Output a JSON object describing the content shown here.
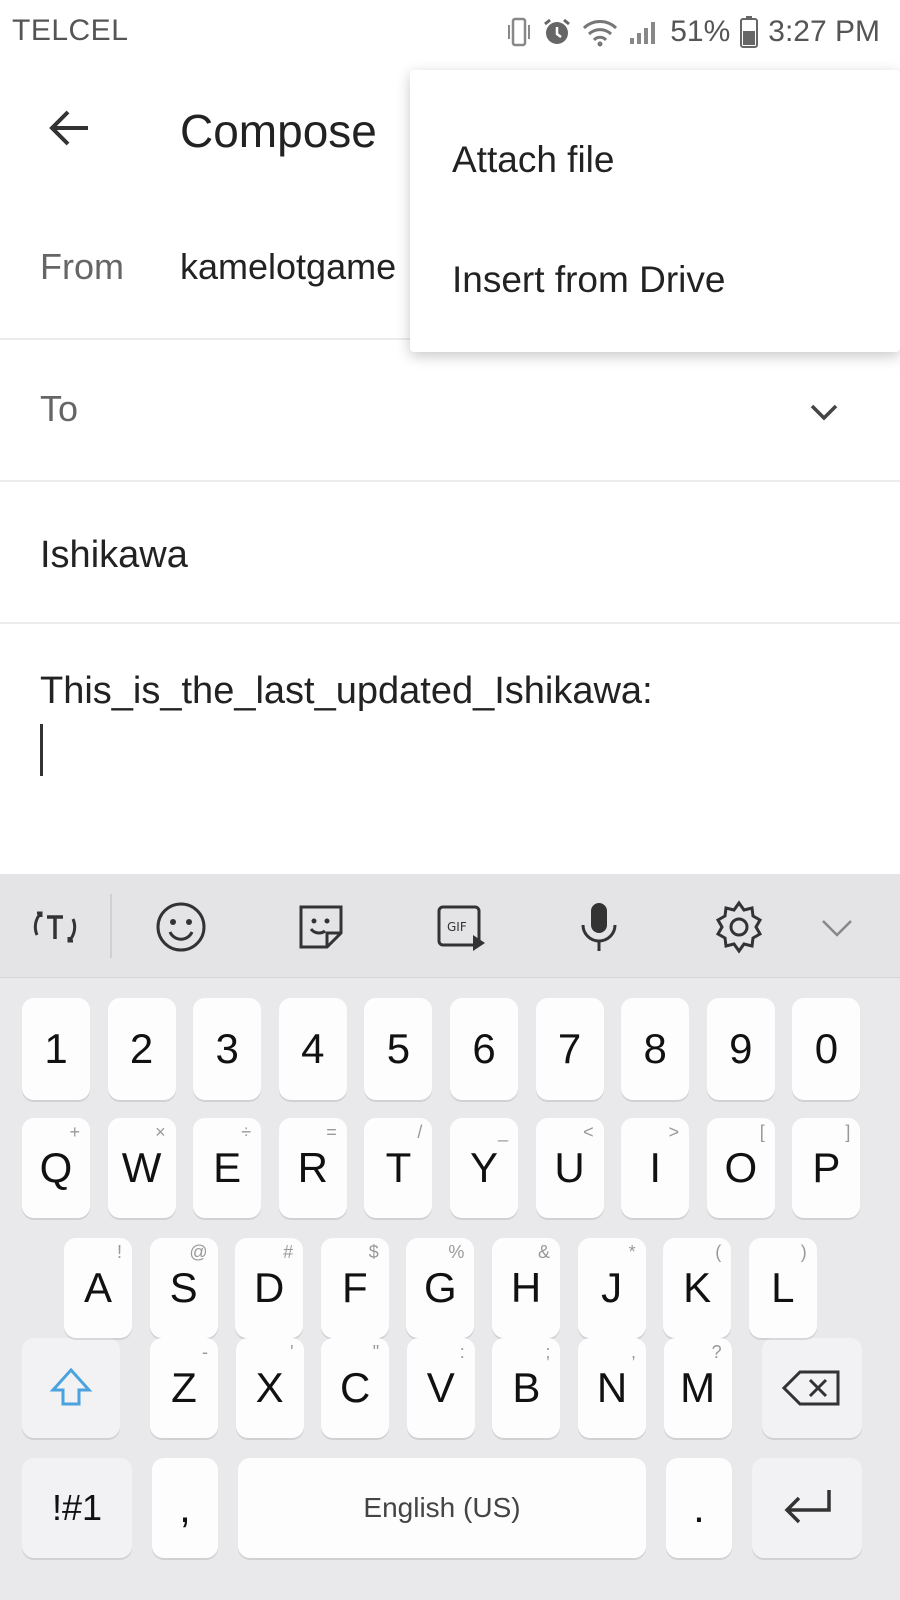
{
  "status_bar": {
    "carrier": "TELCEL",
    "battery": "51%",
    "time": "3:27 PM"
  },
  "app_bar": {
    "title": "Compose"
  },
  "from": {
    "label": "From",
    "value": "kamelotgame"
  },
  "to": {
    "label": "To"
  },
  "subject": {
    "value": "Ishikawa"
  },
  "body": {
    "text": "This_is_the_last_updated_Ishikawa:"
  },
  "menu": {
    "items": [
      "Attach file",
      "Insert from Drive"
    ]
  },
  "keyboard": {
    "row_numbers": [
      "1",
      "2",
      "3",
      "4",
      "5",
      "6",
      "7",
      "8",
      "9",
      "0"
    ],
    "row1": [
      {
        "k": "Q",
        "h": "+"
      },
      {
        "k": "W",
        "h": "×"
      },
      {
        "k": "E",
        "h": "÷"
      },
      {
        "k": "R",
        "h": "="
      },
      {
        "k": "T",
        "h": "/"
      },
      {
        "k": "Y",
        "h": "_"
      },
      {
        "k": "U",
        "h": "<"
      },
      {
        "k": "I",
        "h": ">"
      },
      {
        "k": "O",
        "h": "["
      },
      {
        "k": "P",
        "h": "]"
      }
    ],
    "row2": [
      {
        "k": "A",
        "h": "!"
      },
      {
        "k": "S",
        "h": "@"
      },
      {
        "k": "D",
        "h": "#"
      },
      {
        "k": "F",
        "h": "$"
      },
      {
        "k": "G",
        "h": "%"
      },
      {
        "k": "H",
        "h": "&"
      },
      {
        "k": "J",
        "h": "*"
      },
      {
        "k": "K",
        "h": "("
      },
      {
        "k": "L",
        "h": ")"
      }
    ],
    "row3": [
      {
        "k": "Z",
        "h": "-"
      },
      {
        "k": "X",
        "h": "'"
      },
      {
        "k": "C",
        "h": "\""
      },
      {
        "k": "V",
        "h": ":"
      },
      {
        "k": "B",
        "h": ";"
      },
      {
        "k": "N",
        "h": ","
      },
      {
        "k": "M",
        "h": "?"
      }
    ],
    "symbols_label": "!#1",
    "comma_label": ",",
    "space_label": "English (US)",
    "period_label": "."
  },
  "colors": {
    "shift_accent": "#4aa3df",
    "keyboard_bg": "#e9e9ec"
  }
}
